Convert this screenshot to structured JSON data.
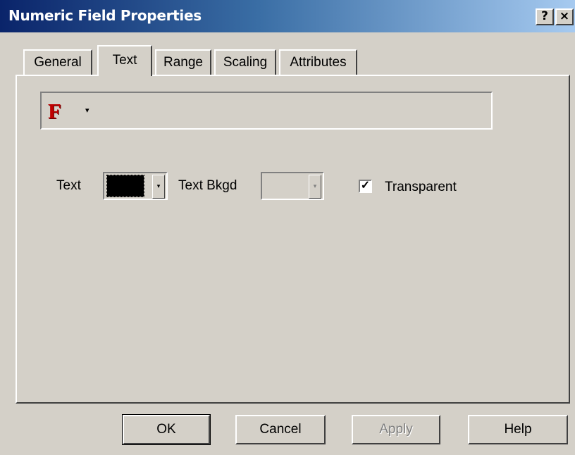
{
  "window": {
    "title": "Numeric Field Properties",
    "help_label": "?",
    "close_label": "×"
  },
  "tabs": [
    {
      "label": "General",
      "active": false
    },
    {
      "label": "Text",
      "active": true
    },
    {
      "label": "Range",
      "active": false
    },
    {
      "label": "Scaling",
      "active": false
    },
    {
      "label": "Attributes",
      "active": false
    }
  ],
  "font_toolbar": {
    "font_icon": "F",
    "dropdown_arrow": "▾"
  },
  "text_color": {
    "label": "Text",
    "color": "#000000",
    "arrow": "▾"
  },
  "text_bkgd_color": {
    "label": "Text Bkgd",
    "color": "#d4d0c8",
    "enabled": false,
    "arrow": "▾"
  },
  "transparent": {
    "label": "Transparent",
    "checked": true,
    "mark": "✓"
  },
  "buttons": {
    "ok": "OK",
    "cancel": "Cancel",
    "apply": "Apply",
    "help": "Help"
  }
}
